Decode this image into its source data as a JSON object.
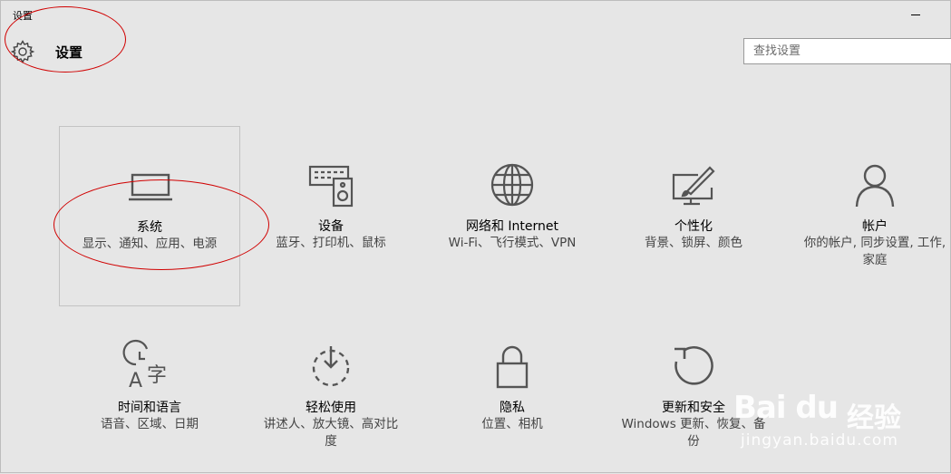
{
  "window": {
    "title": "设置"
  },
  "header": {
    "title": "设置",
    "icon": "gear-icon"
  },
  "search": {
    "placeholder": "查找设置",
    "value": ""
  },
  "tiles": [
    {
      "name": "系统",
      "desc": "显示、通知、应用、电源",
      "icon": "laptop-icon"
    },
    {
      "name": "设备",
      "desc": "蓝牙、打印机、鼠标",
      "icon": "keyboard-speaker-icon"
    },
    {
      "name": "网络和 Internet",
      "desc": "Wi-Fi、飞行模式、VPN",
      "icon": "globe-icon"
    },
    {
      "name": "个性化",
      "desc": "背景、锁屏、颜色",
      "icon": "paint-brush-icon"
    },
    {
      "name": "帐户",
      "desc": "你的帐户, 同步设置, 工作, 家庭",
      "icon": "person-icon"
    },
    {
      "name": "时间和语言",
      "desc": "语音、区域、日期",
      "icon": "time-language-icon"
    },
    {
      "name": "轻松使用",
      "desc": "讲述人、放大镜、高对比度",
      "icon": "ease-of-access-icon"
    },
    {
      "name": "隐私",
      "desc": "位置、相机",
      "icon": "lock-icon"
    },
    {
      "name": "更新和安全",
      "desc": "Windows 更新、恢复、备份",
      "icon": "refresh-icon"
    }
  ],
  "watermark": {
    "brand": "Bai du",
    "product": "经验",
    "url": "jingyan.baidu.com"
  },
  "colors": {
    "background": "#e6e6e6",
    "icon": "#555555",
    "annotation": "#d00000"
  }
}
